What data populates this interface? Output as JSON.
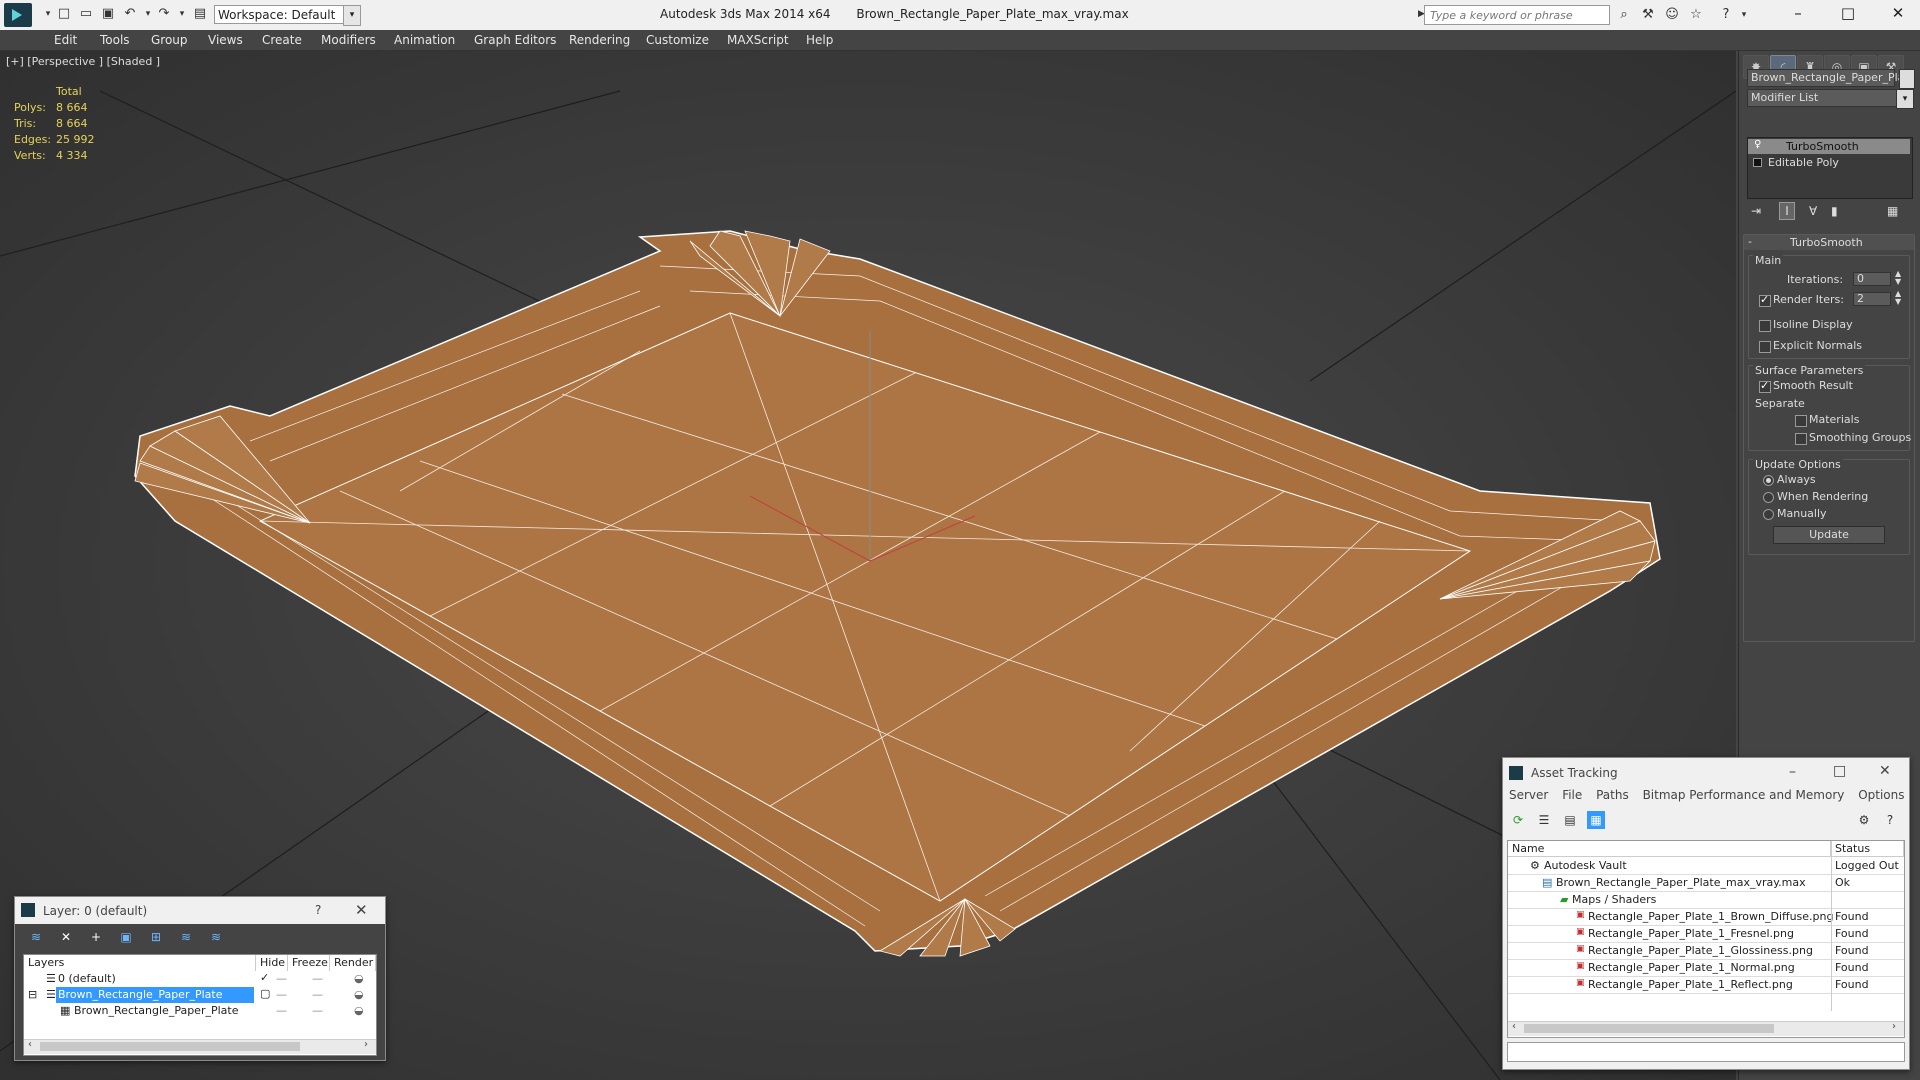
{
  "titlebar": {
    "app_title": "Autodesk 3ds Max  2014 x64",
    "file_name": "Brown_Rectangle_Paper_Plate_max_vray.max",
    "workspace": "Workspace: Default",
    "search_placeholder": "Type a keyword or phrase"
  },
  "menu": [
    "Edit",
    "Tools",
    "Group",
    "Views",
    "Create",
    "Modifiers",
    "Animation",
    "Graph Editors",
    "Rendering",
    "Customize",
    "MAXScript",
    "Help"
  ],
  "viewport": {
    "label": "[+] [Perspective ] [Shaded ]",
    "stats": {
      "header": "Total",
      "rows": [
        {
          "label": "Polys:",
          "value": "8 664"
        },
        {
          "label": "Tris:",
          "value": "8 664"
        },
        {
          "label": "Edges:",
          "value": "25 992"
        },
        {
          "label": "Verts:",
          "value": "4 334"
        }
      ]
    }
  },
  "command_panel": {
    "object_name": "Brown_Rectangle_Paper_Plat",
    "modifier_list": "Modifier List",
    "stack": [
      "TurboSmooth",
      "Editable Poly"
    ],
    "rollout_title": "TurboSmooth",
    "main": {
      "label": "Main",
      "iterations_label": "Iterations:",
      "iterations_value": "0",
      "render_iters_label": "Render Iters:",
      "render_iters_value": "2",
      "isoline": "Isoline Display",
      "explicit_normals": "Explicit Normals"
    },
    "surface": {
      "label": "Surface Parameters",
      "smooth_result": "Smooth Result",
      "separate": "Separate",
      "materials": "Materials",
      "smoothing_groups": "Smoothing Groups"
    },
    "update_options": {
      "label": "Update Options",
      "always": "Always",
      "when_rendering": "When Rendering",
      "manually": "Manually",
      "update_button": "Update"
    }
  },
  "layer_window": {
    "title": "Layer: 0 (default)",
    "help": "?",
    "columns": [
      "Layers",
      "Hide",
      "Freeze",
      "Render"
    ],
    "rows": [
      "0 (default)",
      "Brown_Rectangle_Paper_Plate",
      "Brown_Rectangle_Paper_Plate"
    ]
  },
  "asset_window": {
    "title": "Asset Tracking",
    "menu": [
      "Server",
      "File",
      "Paths",
      "Bitmap Performance and Memory",
      "Options"
    ],
    "columns": [
      "Name",
      "Status"
    ],
    "rows": [
      {
        "name": "Autodesk Vault",
        "status": "Logged Out"
      },
      {
        "name": "Brown_Rectangle_Paper_Plate_max_vray.max",
        "status": "Ok"
      },
      {
        "name": "Maps / Shaders",
        "status": ""
      },
      {
        "name": "Rectangle_Paper_Plate_1_Brown_Diffuse.png",
        "status": "Found"
      },
      {
        "name": "Rectangle_Paper_Plate_1_Fresnel.png",
        "status": "Found"
      },
      {
        "name": "Rectangle_Paper_Plate_1_Glossiness.png",
        "status": "Found"
      },
      {
        "name": "Rectangle_Paper_Plate_1_Normal.png",
        "status": "Found"
      },
      {
        "name": "Rectangle_Paper_Plate_1_Reflect.png",
        "status": "Found"
      }
    ]
  },
  "colors": {
    "plate": "#a8703f",
    "viewport_bg": "#3b3b3b",
    "stats": "#e6d25a",
    "selection": "#3399ff"
  }
}
